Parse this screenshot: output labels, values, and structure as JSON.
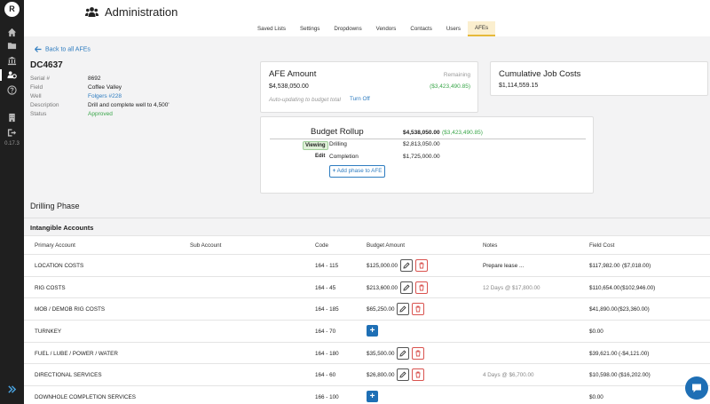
{
  "sidebar": {
    "logo_text": "R",
    "icons": [
      "home-icon",
      "folder-icon",
      "bank-icon",
      "users-cog-icon",
      "help-icon",
      "building-icon",
      "logout-icon"
    ],
    "active": "users-cog-icon",
    "version": "0.17.3",
    "expand_icon": "double-chevron-right-icon"
  },
  "header": {
    "title": "Administration",
    "title_icon": "users-cog-icon",
    "tabs": [
      "Saved Lists",
      "Settings",
      "Dropdowns",
      "Vendors",
      "Contacts",
      "Users",
      "AFEs"
    ],
    "active_tab": "AFEs"
  },
  "back_link": "Back to all AFEs",
  "job": {
    "id": "DC4637",
    "fields": [
      {
        "label": "Serial #",
        "value": "8692"
      },
      {
        "label": "Field",
        "value": "Coffee Valley"
      },
      {
        "label": "Well",
        "value": "Folgers #228"
      },
      {
        "label": "Description",
        "value": "Drill and complete well to 4,500'"
      },
      {
        "label": "Status",
        "value": "Approved"
      }
    ]
  },
  "afe_amount": {
    "title": "AFE Amount",
    "remaining_label": "Remaining",
    "amount": "$4,538,050.00",
    "remaining": "($3,423,490.85)",
    "auto_note": "Auto-updating to budget total",
    "turn_off": "Turn Off"
  },
  "cumulative": {
    "title": "Cumulative Job Costs",
    "amount": "$1,114,559.15"
  },
  "rollup": {
    "title": "Budget Rollup",
    "total": "$4,538,050.00",
    "remaining": "($3,423,490.85)",
    "phases": [
      {
        "action": "Viewing",
        "name": "Drilling",
        "amount": "$2,813,050.00"
      },
      {
        "action": "Edit",
        "name": "Completion",
        "amount": "$1,725,000.00"
      }
    ],
    "add_phase": "Add phase to AFE"
  },
  "phase_title": "Drilling Phase",
  "section": "Intangible Accounts",
  "table": {
    "headers": [
      "Primary Account",
      "Sub Account",
      "Code",
      "Budget Amount",
      "Notes",
      "Field Cost"
    ],
    "rows": [
      {
        "account": "LOCATION COSTS",
        "code": "164 - 115",
        "budget": "$125,000.00",
        "notes": "Prepare lease ...",
        "cost": "$117,982.00",
        "diff": "($7,018.00)",
        "diff_type": "green"
      },
      {
        "account": "RIG COSTS",
        "code": "164 - 45",
        "budget": "$213,600.00",
        "notes": "12 Days @ $17,800.00",
        "cost": "$110,654.00",
        "diff": "($102,946.00)",
        "diff_type": "green"
      },
      {
        "account": "MOB / DEMOB RIG COSTS",
        "code": "164 - 185",
        "budget": "$65,250.00",
        "notes": "",
        "cost": "$41,890.00",
        "diff": "($23,360.00)",
        "diff_type": "green"
      },
      {
        "account": "TURNKEY",
        "code": "164 - 70",
        "budget": "",
        "notes": "",
        "cost": "$0.00",
        "diff": "",
        "diff_type": ""
      },
      {
        "account": "FUEL / LUBE / POWER / WATER",
        "code": "164 - 180",
        "budget": "$35,500.00",
        "notes": "",
        "cost": "$39,621.00",
        "diff": "(-$4,121.00)",
        "diff_type": "red"
      },
      {
        "account": "DIRECTIONAL SERVICES",
        "code": "164 - 60",
        "budget": "$26,800.00",
        "notes": "4 Days @ $6,700.00",
        "cost": "$10,598.00",
        "diff": "($16,202.00)",
        "diff_type": "green"
      },
      {
        "account": "DOWNHOLE COMPLETION SERVICES",
        "code": "166 - 100",
        "budget": "",
        "notes": "",
        "cost": "$0.00",
        "diff": "",
        "diff_type": ""
      }
    ]
  },
  "colors": {
    "accent": "#2e7cc0",
    "positive": "#3aa64a",
    "negative": "#d9534f",
    "active_tab_bg": "#fbefcf",
    "sidebar_bg": "#1f1f1f"
  }
}
